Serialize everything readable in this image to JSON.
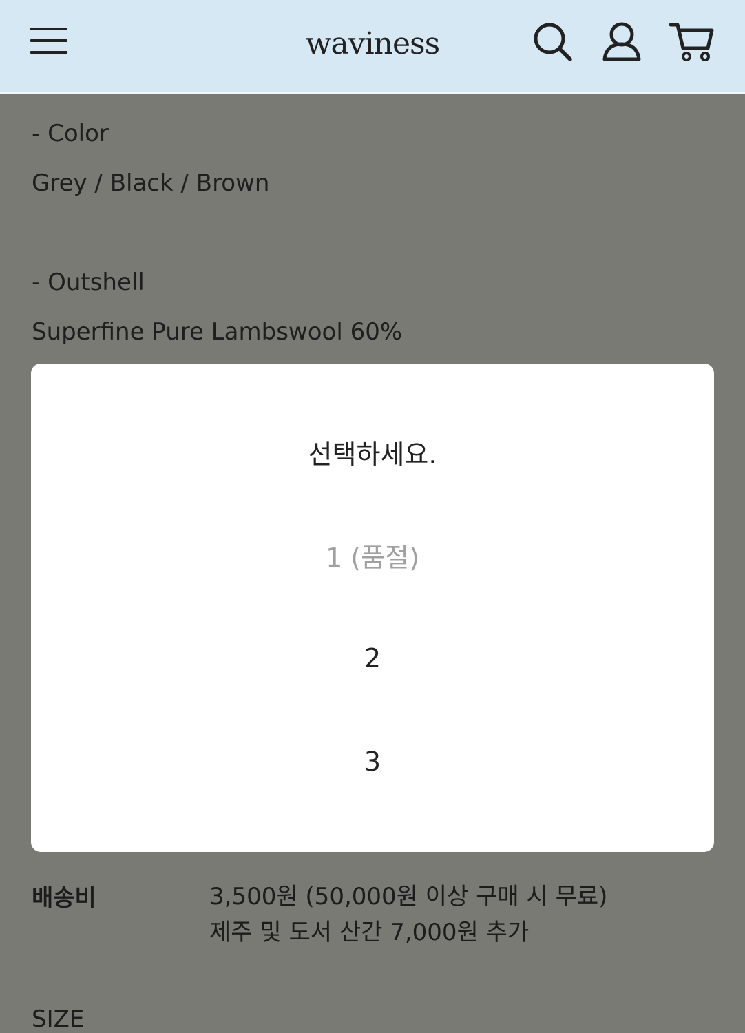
{
  "header": {
    "logo": "waviness",
    "icons": {
      "menu": "hamburger-menu-icon",
      "search": "search-icon",
      "account": "user-icon",
      "cart": "cart-icon"
    }
  },
  "details": {
    "color_heading": "- Color",
    "color_value": "Grey / Black / Brown",
    "outshell_heading": "- Outshell",
    "outshell_value": "Superfine Pure Lambswool 60%"
  },
  "dialog": {
    "options": [
      {
        "label": "선택하세요.",
        "disabled": false
      },
      {
        "label": "1 (품절)",
        "disabled": true
      },
      {
        "label": "2",
        "disabled": false
      },
      {
        "label": "3",
        "disabled": false
      }
    ]
  },
  "shipping": {
    "label": "배송비",
    "line1": "3,500원 (50,000원 이상 구매 시 무료)",
    "line2": "제주 및 도서 산간 7,000원 추가"
  },
  "size": {
    "label": "SIZE"
  },
  "colors": {
    "header_bg": "#d6e8f4",
    "overlay_bg": "#797a74",
    "disabled_text": "#a0a0a0"
  }
}
